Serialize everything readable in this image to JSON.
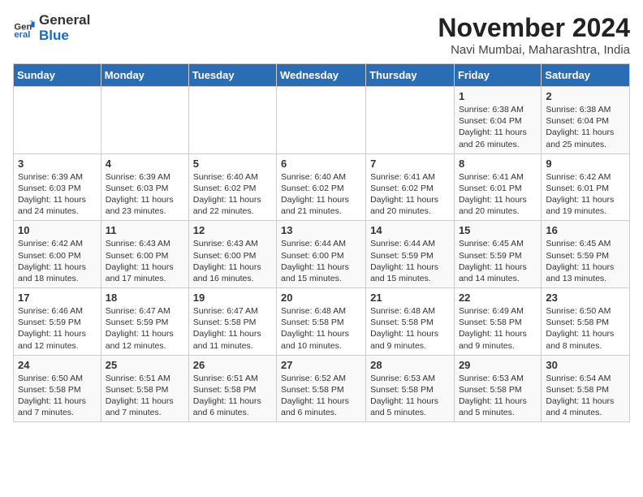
{
  "logo": {
    "text_general": "General",
    "text_blue": "Blue"
  },
  "title": "November 2024",
  "subtitle": "Navi Mumbai, Maharashtra, India",
  "days_of_week": [
    "Sunday",
    "Monday",
    "Tuesday",
    "Wednesday",
    "Thursday",
    "Friday",
    "Saturday"
  ],
  "weeks": [
    [
      {
        "day": "",
        "info": ""
      },
      {
        "day": "",
        "info": ""
      },
      {
        "day": "",
        "info": ""
      },
      {
        "day": "",
        "info": ""
      },
      {
        "day": "",
        "info": ""
      },
      {
        "day": "1",
        "info": "Sunrise: 6:38 AM\nSunset: 6:04 PM\nDaylight: 11 hours and 26 minutes."
      },
      {
        "day": "2",
        "info": "Sunrise: 6:38 AM\nSunset: 6:04 PM\nDaylight: 11 hours and 25 minutes."
      }
    ],
    [
      {
        "day": "3",
        "info": "Sunrise: 6:39 AM\nSunset: 6:03 PM\nDaylight: 11 hours and 24 minutes."
      },
      {
        "day": "4",
        "info": "Sunrise: 6:39 AM\nSunset: 6:03 PM\nDaylight: 11 hours and 23 minutes."
      },
      {
        "day": "5",
        "info": "Sunrise: 6:40 AM\nSunset: 6:02 PM\nDaylight: 11 hours and 22 minutes."
      },
      {
        "day": "6",
        "info": "Sunrise: 6:40 AM\nSunset: 6:02 PM\nDaylight: 11 hours and 21 minutes."
      },
      {
        "day": "7",
        "info": "Sunrise: 6:41 AM\nSunset: 6:02 PM\nDaylight: 11 hours and 20 minutes."
      },
      {
        "day": "8",
        "info": "Sunrise: 6:41 AM\nSunset: 6:01 PM\nDaylight: 11 hours and 20 minutes."
      },
      {
        "day": "9",
        "info": "Sunrise: 6:42 AM\nSunset: 6:01 PM\nDaylight: 11 hours and 19 minutes."
      }
    ],
    [
      {
        "day": "10",
        "info": "Sunrise: 6:42 AM\nSunset: 6:00 PM\nDaylight: 11 hours and 18 minutes."
      },
      {
        "day": "11",
        "info": "Sunrise: 6:43 AM\nSunset: 6:00 PM\nDaylight: 11 hours and 17 minutes."
      },
      {
        "day": "12",
        "info": "Sunrise: 6:43 AM\nSunset: 6:00 PM\nDaylight: 11 hours and 16 minutes."
      },
      {
        "day": "13",
        "info": "Sunrise: 6:44 AM\nSunset: 6:00 PM\nDaylight: 11 hours and 15 minutes."
      },
      {
        "day": "14",
        "info": "Sunrise: 6:44 AM\nSunset: 5:59 PM\nDaylight: 11 hours and 15 minutes."
      },
      {
        "day": "15",
        "info": "Sunrise: 6:45 AM\nSunset: 5:59 PM\nDaylight: 11 hours and 14 minutes."
      },
      {
        "day": "16",
        "info": "Sunrise: 6:45 AM\nSunset: 5:59 PM\nDaylight: 11 hours and 13 minutes."
      }
    ],
    [
      {
        "day": "17",
        "info": "Sunrise: 6:46 AM\nSunset: 5:59 PM\nDaylight: 11 hours and 12 minutes."
      },
      {
        "day": "18",
        "info": "Sunrise: 6:47 AM\nSunset: 5:59 PM\nDaylight: 11 hours and 12 minutes."
      },
      {
        "day": "19",
        "info": "Sunrise: 6:47 AM\nSunset: 5:58 PM\nDaylight: 11 hours and 11 minutes."
      },
      {
        "day": "20",
        "info": "Sunrise: 6:48 AM\nSunset: 5:58 PM\nDaylight: 11 hours and 10 minutes."
      },
      {
        "day": "21",
        "info": "Sunrise: 6:48 AM\nSunset: 5:58 PM\nDaylight: 11 hours and 9 minutes."
      },
      {
        "day": "22",
        "info": "Sunrise: 6:49 AM\nSunset: 5:58 PM\nDaylight: 11 hours and 9 minutes."
      },
      {
        "day": "23",
        "info": "Sunrise: 6:50 AM\nSunset: 5:58 PM\nDaylight: 11 hours and 8 minutes."
      }
    ],
    [
      {
        "day": "24",
        "info": "Sunrise: 6:50 AM\nSunset: 5:58 PM\nDaylight: 11 hours and 7 minutes."
      },
      {
        "day": "25",
        "info": "Sunrise: 6:51 AM\nSunset: 5:58 PM\nDaylight: 11 hours and 7 minutes."
      },
      {
        "day": "26",
        "info": "Sunrise: 6:51 AM\nSunset: 5:58 PM\nDaylight: 11 hours and 6 minutes."
      },
      {
        "day": "27",
        "info": "Sunrise: 6:52 AM\nSunset: 5:58 PM\nDaylight: 11 hours and 6 minutes."
      },
      {
        "day": "28",
        "info": "Sunrise: 6:53 AM\nSunset: 5:58 PM\nDaylight: 11 hours and 5 minutes."
      },
      {
        "day": "29",
        "info": "Sunrise: 6:53 AM\nSunset: 5:58 PM\nDaylight: 11 hours and 5 minutes."
      },
      {
        "day": "30",
        "info": "Sunrise: 6:54 AM\nSunset: 5:58 PM\nDaylight: 11 hours and 4 minutes."
      }
    ]
  ]
}
